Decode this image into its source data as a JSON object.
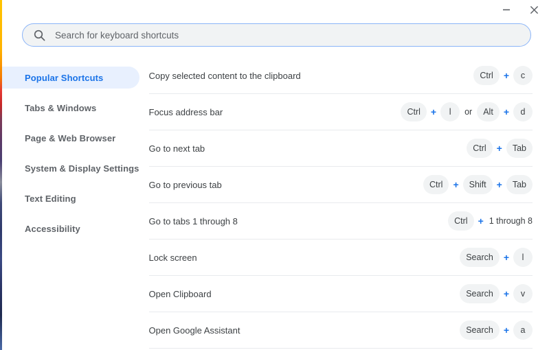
{
  "window": {
    "titlebar": {
      "minimize_label": "Minimize",
      "minimize_icon": "minimize-icon",
      "close_label": "Close",
      "close_icon": "close-icon"
    }
  },
  "search": {
    "icon": "search-icon",
    "placeholder": "Search for keyboard shortcuts",
    "value": ""
  },
  "sidebar": {
    "items": [
      {
        "label": "Popular Shortcuts",
        "selected": true
      },
      {
        "label": "Tabs & Windows",
        "selected": false
      },
      {
        "label": "Page & Web Browser",
        "selected": false
      },
      {
        "label": "System & Display Settings",
        "selected": false
      },
      {
        "label": "Text Editing",
        "selected": false
      },
      {
        "label": "Accessibility",
        "selected": false
      }
    ]
  },
  "shortcuts": {
    "rows": [
      {
        "label": "Copy selected content to the clipboard",
        "keys": [
          {
            "type": "key",
            "text": "Ctrl"
          },
          {
            "type": "plus",
            "text": "+"
          },
          {
            "type": "key",
            "text": "c"
          }
        ]
      },
      {
        "label": "Focus address bar",
        "keys": [
          {
            "type": "key",
            "text": "Ctrl"
          },
          {
            "type": "plus",
            "text": "+"
          },
          {
            "type": "key",
            "text": "l"
          },
          {
            "type": "sep",
            "text": "or"
          },
          {
            "type": "key",
            "text": "Alt"
          },
          {
            "type": "plus",
            "text": "+"
          },
          {
            "type": "key",
            "text": "d"
          }
        ]
      },
      {
        "label": "Go to next tab",
        "keys": [
          {
            "type": "key",
            "text": "Ctrl"
          },
          {
            "type": "plus",
            "text": "+"
          },
          {
            "type": "key",
            "text": "Tab"
          }
        ]
      },
      {
        "label": "Go to previous tab",
        "keys": [
          {
            "type": "key",
            "text": "Ctrl"
          },
          {
            "type": "plus",
            "text": "+"
          },
          {
            "type": "key",
            "text": "Shift"
          },
          {
            "type": "plus",
            "text": "+"
          },
          {
            "type": "key",
            "text": "Tab"
          }
        ]
      },
      {
        "label": "Go to tabs 1 through 8",
        "keys": [
          {
            "type": "key",
            "text": "Ctrl"
          },
          {
            "type": "plus",
            "text": "+"
          },
          {
            "type": "plaintext",
            "text": "1 through 8"
          }
        ]
      },
      {
        "label": "Lock screen",
        "keys": [
          {
            "type": "key",
            "text": "Search"
          },
          {
            "type": "plus",
            "text": "+"
          },
          {
            "type": "key",
            "text": "l"
          }
        ]
      },
      {
        "label": "Open Clipboard",
        "keys": [
          {
            "type": "key",
            "text": "Search"
          },
          {
            "type": "plus",
            "text": "+"
          },
          {
            "type": "key",
            "text": "v"
          }
        ]
      },
      {
        "label": "Open Google Assistant",
        "keys": [
          {
            "type": "key",
            "text": "Search"
          },
          {
            "type": "plus",
            "text": "+"
          },
          {
            "type": "key",
            "text": "a"
          }
        ]
      }
    ]
  },
  "colors": {
    "accent": "#1a73e8",
    "selected_bg": "#e8f0fe",
    "key_bg": "#f1f3f4",
    "text": "#3c4043",
    "muted_text": "#5f6368",
    "divider": "#e8eaed",
    "search_border": "#8ab4f8"
  }
}
